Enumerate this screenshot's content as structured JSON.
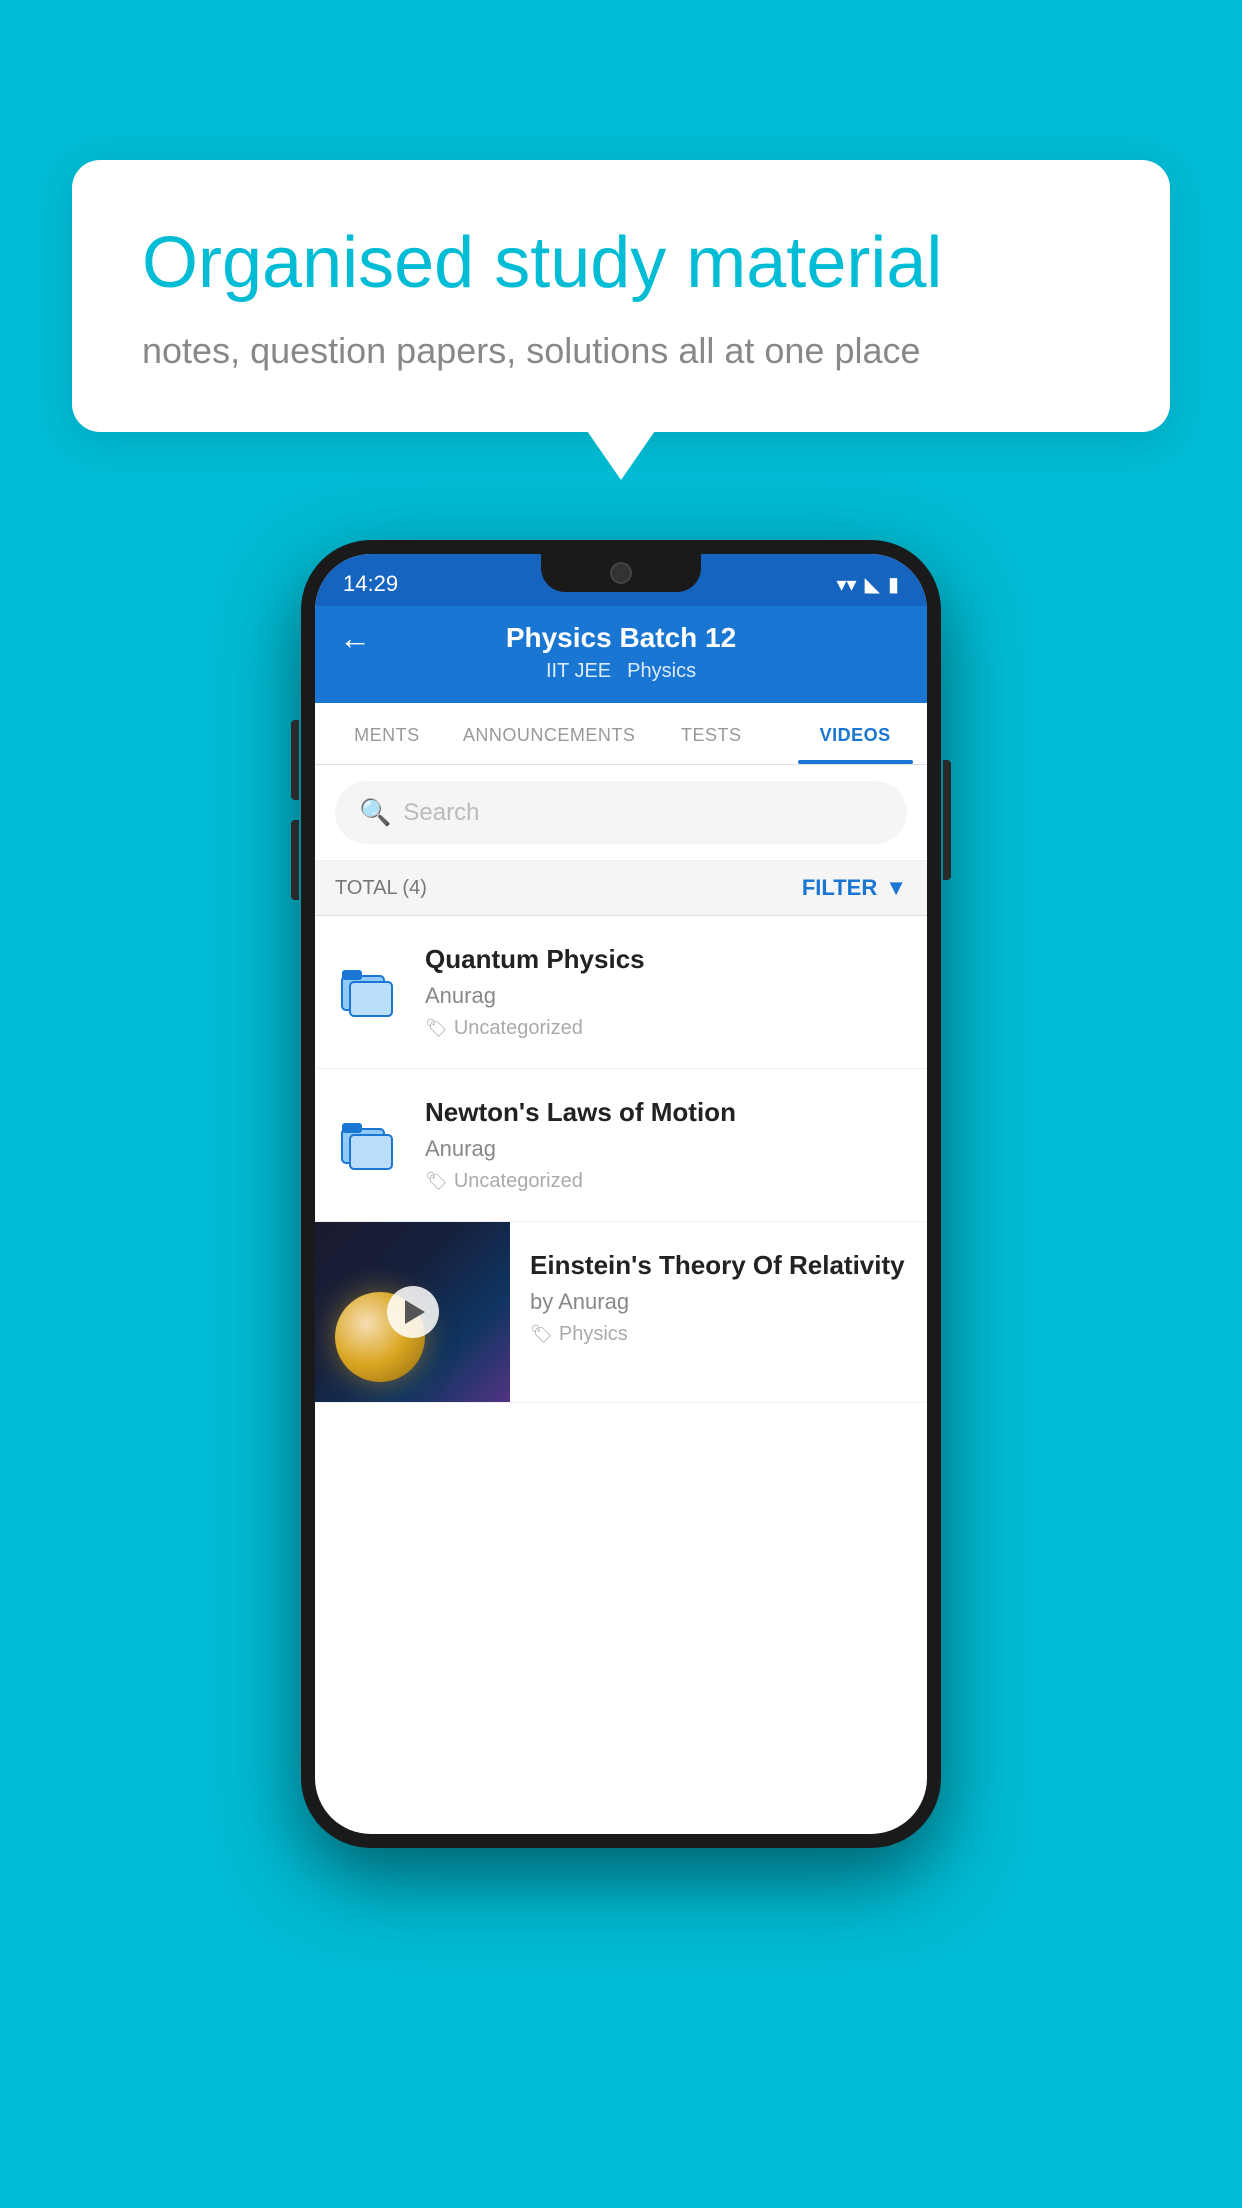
{
  "page": {
    "background_color": "#00bcd4"
  },
  "bubble": {
    "title": "Organised study material",
    "subtitle": "notes, question papers, solutions all at one place"
  },
  "status_bar": {
    "time": "14:29",
    "icons": [
      "wifi",
      "signal",
      "battery"
    ]
  },
  "header": {
    "title": "Physics Batch 12",
    "subtitle_part1": "IIT JEE",
    "subtitle_part2": "Physics",
    "back_label": "←"
  },
  "tabs": [
    {
      "label": "MENTS",
      "active": false
    },
    {
      "label": "ANNOUNCEMENTS",
      "active": false
    },
    {
      "label": "TESTS",
      "active": false
    },
    {
      "label": "VIDEOS",
      "active": true
    }
  ],
  "search": {
    "placeholder": "Search"
  },
  "filter": {
    "total_label": "TOTAL (4)",
    "filter_label": "FILTER"
  },
  "videos": [
    {
      "title": "Quantum Physics",
      "author": "Anurag",
      "tag": "Uncategorized",
      "has_thumb": false
    },
    {
      "title": "Newton's Laws of Motion",
      "author": "Anurag",
      "tag": "Uncategorized",
      "has_thumb": false
    },
    {
      "title": "Einstein's Theory Of Relativity",
      "author": "by Anurag",
      "tag": "Physics",
      "has_thumb": true
    }
  ]
}
